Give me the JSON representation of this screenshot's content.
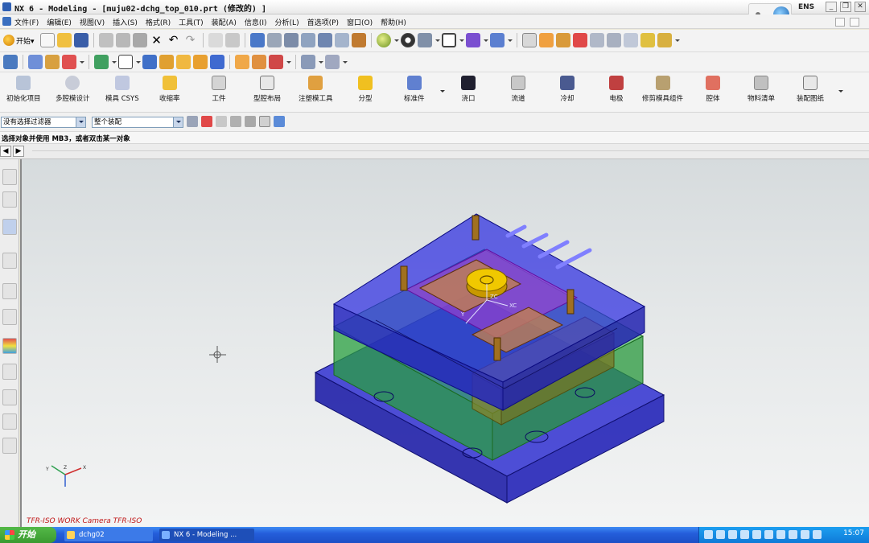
{
  "window": {
    "title": "NX 6 - Modeling - [muju02-dchg_top_010.prt  (修改的) ]",
    "lang_indicator": "ENS",
    "buttons": [
      "_",
      "❐",
      "✕"
    ]
  },
  "menubar": {
    "items": [
      "文件(F)",
      "编辑(E)",
      "视图(V)",
      "插入(S)",
      "格式(R)",
      "工具(T)",
      "装配(A)",
      "信息(I)",
      "分析(L)",
      "首选项(P)",
      "窗口(O)",
      "帮助(H)"
    ]
  },
  "standard_toolbar": {
    "start_label": "开始▾"
  },
  "mold_toolbar": {
    "buttons": [
      "初始化项目",
      "多腔模设计",
      "模具 CSYS",
      "收缩率",
      "工件",
      "型腔布局",
      "注塑模工具",
      "分型",
      "标准件",
      "浇口",
      "流道",
      "冷却",
      "电极",
      "修剪模具组件",
      "腔体",
      "物料清单",
      "装配图纸"
    ]
  },
  "selection_bar": {
    "type_filter": "没有选择过滤器",
    "scope": "整个装配"
  },
  "cue_line": {
    "text": "选择对象并使用 MB3，或者双击某一对象"
  },
  "viewport": {
    "caption": "TFR-ISO WORK Camera TFR-ISO",
    "triad_labels": [
      "Y",
      "Z",
      "X"
    ],
    "model_triad_labels": [
      "Y",
      "ZC",
      "XC"
    ]
  },
  "taskbar": {
    "start_label": "开始",
    "tasks": [
      "dchg02",
      "NX 6 - Modeling ..."
    ],
    "clock": "15:07"
  },
  "colors": {
    "plate_blue": "#2c2cd8",
    "plate_green": "#32c050",
    "core_red": "#d05050",
    "sprue_gold": "#e8b800",
    "caption_red": "#c01818"
  }
}
